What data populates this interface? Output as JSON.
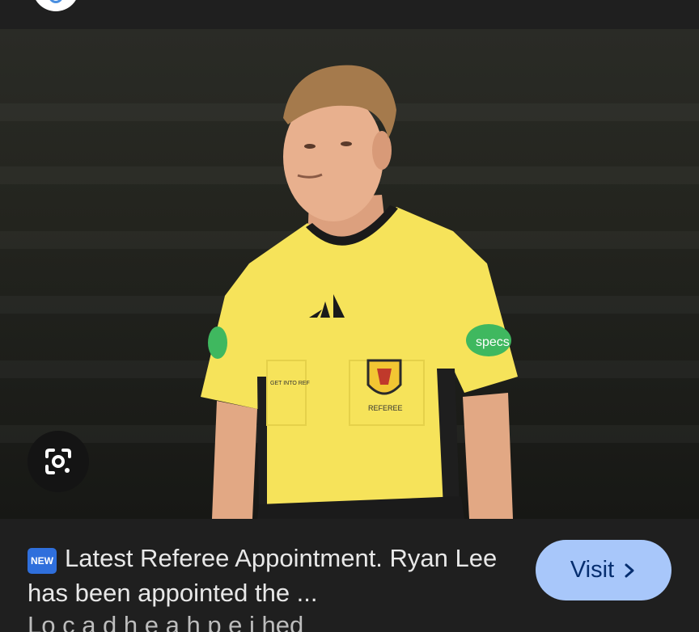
{
  "photo": {
    "alt": "",
    "shirt_badges": {
      "sponsor": "specs",
      "crest_caption": "REFEREE",
      "patch_text": "GET INTO REF"
    }
  },
  "lens": {
    "icon": "google-lens-icon"
  },
  "caption": {
    "badge": "NEW",
    "text": "Latest Referee Appointment. Ryan Lee has been appointed the ...",
    "next_line": "Lo c  a d   h e a   h  p  e  i  hed"
  },
  "visit": {
    "label": "Visit",
    "icon": "chevron-right-icon"
  },
  "colors": {
    "background": "#1f1f1f",
    "visit_button": "#a8c7fa",
    "visit_text": "#062e6f",
    "badge_blue": "#2f6fdc",
    "shirt_yellow": "#f6e35a"
  }
}
